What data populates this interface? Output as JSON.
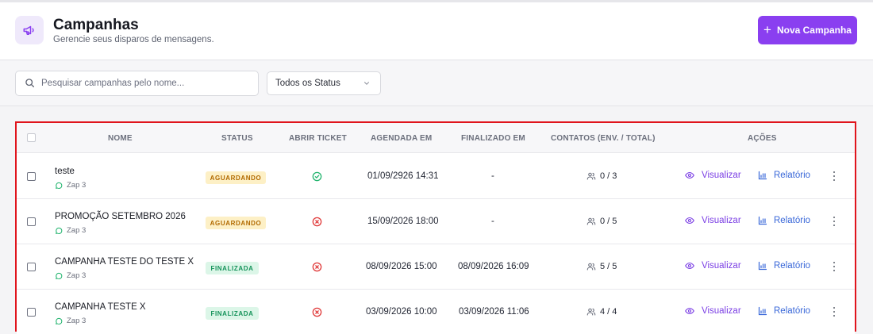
{
  "header": {
    "title": "Campanhas",
    "subtitle": "Gerencie seus disparos de mensagens.",
    "new_button_label": "Nova Campanha"
  },
  "filters": {
    "search_placeholder": "Pesquisar campanhas pelo nome...",
    "status_select_value": "Todos os Status"
  },
  "table": {
    "columns": [
      "NOME",
      "STATUS",
      "ABRIR TICKET",
      "AGENDADA EM",
      "FINALIZADO EM",
      "CONTATOS (ENV. / TOTAL)",
      "AÇÕES"
    ],
    "rows": [
      {
        "name": "teste",
        "connection": "Zap 3",
        "status": "AGUARDANDO",
        "status_color": "#b26a00",
        "status_bg": "#fdf0c6",
        "open_ticket": "check-circle-icon",
        "scheduled": "01/09/2926 14:31",
        "finished": "-",
        "contacts": "0 / 3"
      },
      {
        "name": "PROMOÇÃO SETEMBRO 2026",
        "connection": "Zap 3",
        "status": "AGUARDANDO",
        "status_color": "#b26a00",
        "status_bg": "#fdf0c6",
        "open_ticket": "x-circle-icon",
        "scheduled": "15/09/2026 18:00",
        "finished": "-",
        "contacts": "0 / 5"
      },
      {
        "name": "CAMPANHA TESTE DO TESTE X",
        "connection": "Zap 3",
        "status": "FINALIZADA",
        "status_color": "#15935a",
        "status_bg": "#dcf6e8",
        "open_ticket": "x-circle-icon",
        "scheduled": "08/09/2026 15:00",
        "finished": "08/09/2026 16:09",
        "contacts": "5 / 5"
      },
      {
        "name": "CAMPANHA TESTE X",
        "connection": "Zap 3",
        "status": "FINALIZADA",
        "status_color": "#15935a",
        "status_bg": "#dcf6e8",
        "open_ticket": "x-circle-icon",
        "scheduled": "03/09/2026 10:00",
        "finished": "03/09/2026 11:06",
        "contacts": "4 / 4"
      }
    ],
    "actions": {
      "view_label": "Visualizar",
      "report_label": "Relatório"
    }
  },
  "colors": {
    "accent": "#8a3ff0",
    "view_link": "#7b3fe4",
    "report_link": "#3766d8",
    "success": "#22b46e",
    "danger": "#e03a3a",
    "highlight_border": "#e0141c"
  }
}
